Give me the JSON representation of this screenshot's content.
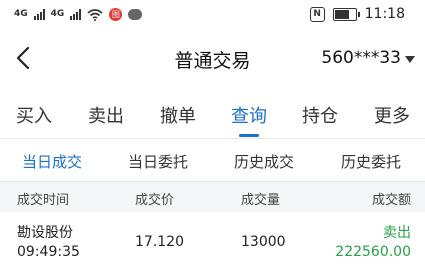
{
  "status_bar": {
    "network_label": "4G",
    "time": "11:18",
    "nfc_label": "N",
    "notification_label": "图"
  },
  "header": {
    "title": "普通交易",
    "account": "560***33"
  },
  "main_tabs": [
    "买入",
    "卖出",
    "撤单",
    "查询",
    "持仓",
    "更多"
  ],
  "sub_tabs": [
    "当日成交",
    "当日委托",
    "历史成交",
    "历史委托"
  ],
  "table": {
    "columns": [
      "成交时间",
      "成交价",
      "成交量",
      "成交额"
    ],
    "rows": [
      {
        "name": "勘设股份",
        "time": "09:49:35",
        "price": "17.120",
        "volume": "13000",
        "side": "卖出",
        "amount": "222560.00"
      }
    ]
  },
  "colors": {
    "accent": "#1a6fc9",
    "sell": "#23a345"
  }
}
